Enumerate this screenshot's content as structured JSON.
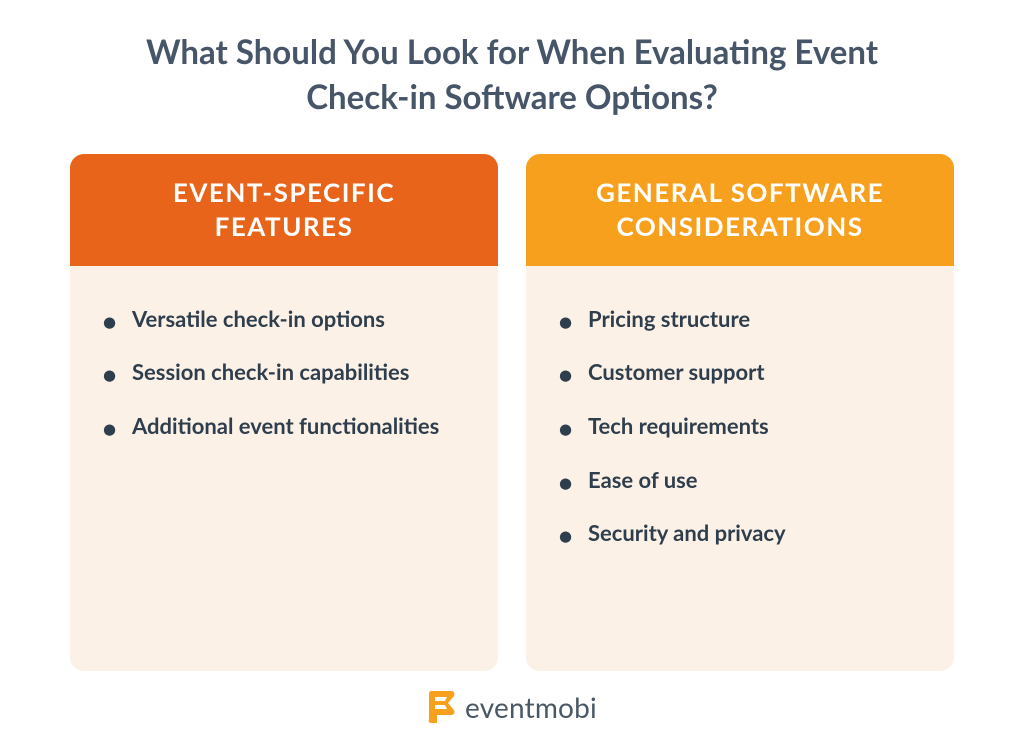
{
  "title": "What Should You Look for When Evaluating Event Check-in Software Options?",
  "cards": [
    {
      "header": "EVENT-SPECIFIC FEATURES",
      "items": [
        "Versatile check-in options",
        "Session check-in capabilities",
        "Additional event functionalities"
      ]
    },
    {
      "header": "GENERAL SOFTWARE CONSIDERATIONS",
      "items": [
        "Pricing structure",
        "Customer support",
        "Tech requirements",
        "Ease of use",
        "Security and privacy"
      ]
    }
  ],
  "logo": {
    "name": "eventmobi"
  }
}
